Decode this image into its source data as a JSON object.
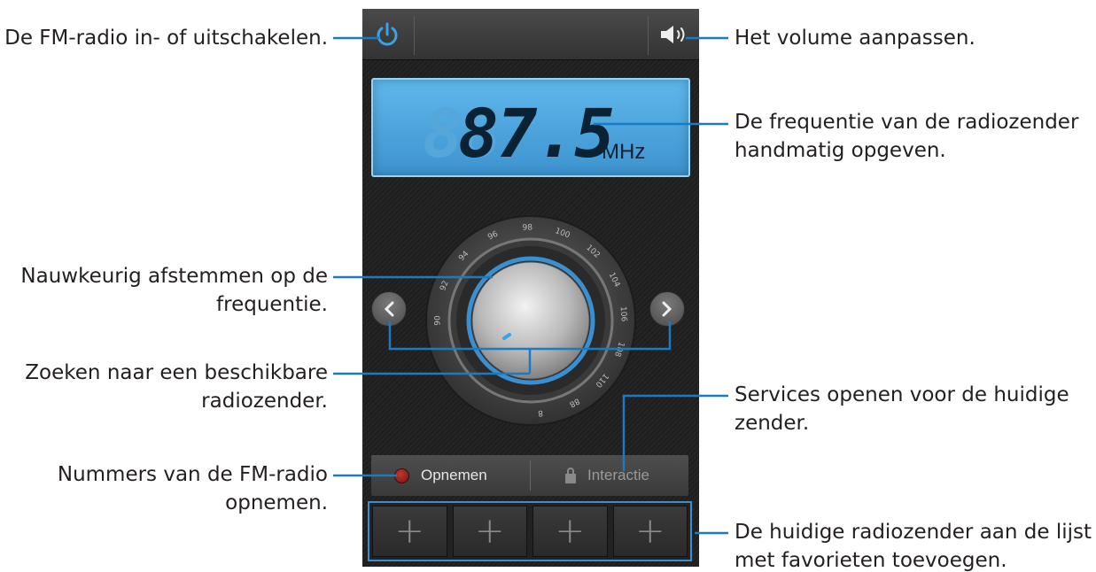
{
  "screen": {
    "frequency": "87.5",
    "frequency_ghost": "88",
    "unit": "MHz",
    "record_label": "Opnemen",
    "interact_label": "Interactie",
    "dial_ticks": [
      "90",
      "92",
      "94",
      "96",
      "98",
      "100",
      "102",
      "104",
      "106",
      "108",
      "110",
      "88",
      "8"
    ],
    "favorites": [
      "+",
      "+",
      "+",
      "+"
    ]
  },
  "annotations": {
    "power": "De FM-radio in- of uitschakelen.",
    "volume": "Het volume aanpassen.",
    "frequency_line1": "De frequentie van de radiozender",
    "frequency_line2": "handmatig opgeven.",
    "finetune_line1": "Nauwkeurig afstemmen op de",
    "finetune_line2": "frequentie.",
    "search_line1": "Zoeken naar een beschikbare",
    "search_line2": "radiozender.",
    "services_line1": "Services openen voor de huidige",
    "services_line2": "zender.",
    "record_line1": "Nummers van de FM-radio",
    "record_line2": "opnemen.",
    "favorites_line1": "De huidige radiozender aan de lijst",
    "favorites_line2": "met favorieten toevoegen."
  },
  "colors": {
    "accent": "#3a8fd0",
    "display": "#4aa5e0",
    "record_dot": "#8b1a1a"
  }
}
